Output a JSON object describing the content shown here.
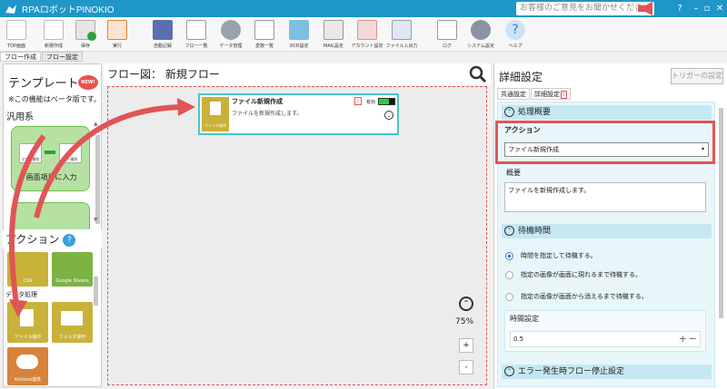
{
  "titlebar": {
    "app_name": "RPAロボットPINOKIO",
    "opinion_text": "お客様のご意見をお聞かせください"
  },
  "toolbar": {
    "items": [
      {
        "label": "TOP画面",
        "icon": "top-icon"
      },
      {
        "label": "新規作成",
        "icon": "new-file-icon"
      },
      {
        "label": "保存",
        "icon": "save-icon"
      },
      {
        "label": "実行",
        "icon": "run-icon"
      },
      {
        "label": "自動記録",
        "icon": "record-icon"
      },
      {
        "label": "フロー一覧",
        "icon": "list-icon"
      },
      {
        "label": "データ管理",
        "icon": "data-icon"
      },
      {
        "label": "変数一覧",
        "icon": "variable-icon"
      },
      {
        "label": "OCR設定",
        "icon": "ocr-icon"
      },
      {
        "label": "MAIL設定",
        "icon": "mail-icon"
      },
      {
        "label": "アカウント設定",
        "icon": "account-icon"
      },
      {
        "label": "ファイル入出力",
        "icon": "file-io-icon"
      },
      {
        "label": "ログ",
        "icon": "log-icon"
      },
      {
        "label": "システム設定",
        "icon": "system-gear-icon"
      },
      {
        "label": "ヘルプ",
        "icon": "help-icon"
      }
    ]
  },
  "tabs": [
    "フロー作成",
    "フロー設定"
  ],
  "left": {
    "template_title": "テンプレート",
    "new_badge": "NEW!",
    "beta_note": "※この機能はベータ版です。",
    "category": "汎用系",
    "template_card_label": "画面項目に入力",
    "template_card_mini1": "マウス操作",
    "template_card_mini2": "キー操作",
    "action_title": "アクション",
    "action_help": "?",
    "section_label": "データ処理",
    "tiles": [
      {
        "label": "CSV",
        "color": "#c8b23a"
      },
      {
        "label": "Google Sheets",
        "color": "#7cb342"
      },
      {
        "label": "ファイル操作",
        "color": "#c8b23a"
      },
      {
        "label": "フォルダ操作",
        "color": "#c8b23a"
      },
      {
        "label": "Kintone連携",
        "color": "#d9823b"
      }
    ]
  },
  "canvas": {
    "title": "フロー図： 新規フロー",
    "node": {
      "title": "ファイル新規作成",
      "desc": "ファイルを新規作成します。",
      "icon_label": "ファイル操作",
      "warn": "!",
      "enabled_label": "有効"
    },
    "zoom": "75%",
    "zoom_in": "+",
    "zoom_out": "-"
  },
  "right": {
    "title": "詳細設定",
    "trigger_button": "トリガーの設定",
    "tab_common": "共通設定",
    "tab_detail": "詳細設定",
    "tab_warn": "!",
    "section_processing": "処理概要",
    "action_label": "アクション",
    "action_value": "ファイル新規作成",
    "summary_label": "概要",
    "summary_value": "ファイルを新規作成します。",
    "section_wait": "待機時間",
    "radio_options": [
      "時間を指定して待機する。",
      "指定の画像が画面に現れるまで待機する。",
      "指定の画像が画面から消えるまで待機する。"
    ],
    "radio_selected": 0,
    "time_label": "時間設定",
    "time_value": "0.5",
    "section_error": "エラー発生時フロー停止設定"
  }
}
